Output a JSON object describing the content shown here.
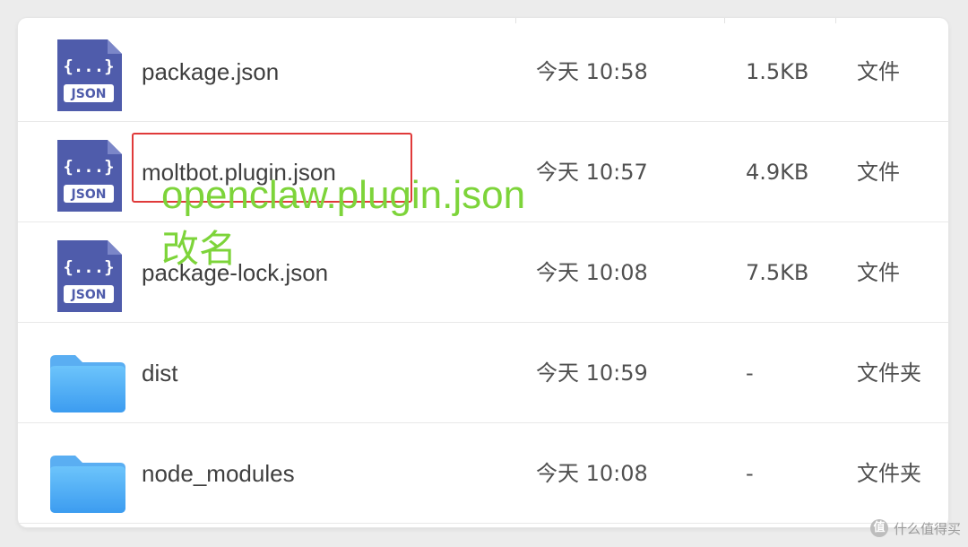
{
  "files": [
    {
      "name": "package.json",
      "date": "今天 10:58",
      "size": "1.5KB",
      "kind": "文件",
      "icon": "json-file-icon"
    },
    {
      "name": "moltbot.plugin.json",
      "date": "今天 10:57",
      "size": "4.9KB",
      "kind": "文件",
      "icon": "json-file-icon"
    },
    {
      "name": "package-lock.json",
      "date": "今天 10:08",
      "size": "7.5KB",
      "kind": "文件",
      "icon": "json-file-icon"
    },
    {
      "name": "dist",
      "date": "今天 10:59",
      "size": "-",
      "kind": "文件夹",
      "icon": "folder-icon"
    },
    {
      "name": "node_modules",
      "date": "今天 10:08",
      "size": "-",
      "kind": "文件夹",
      "icon": "folder-icon"
    }
  ],
  "json_icon_label": "JSON",
  "json_icon_braces": "{...}",
  "annotation": {
    "line1": "openclaw.plugin.json",
    "line2": "改名",
    "color": "#7dd43a",
    "box_color": "#e03a3a"
  },
  "watermark": {
    "icon_text": "值",
    "text": "什么值得买"
  }
}
